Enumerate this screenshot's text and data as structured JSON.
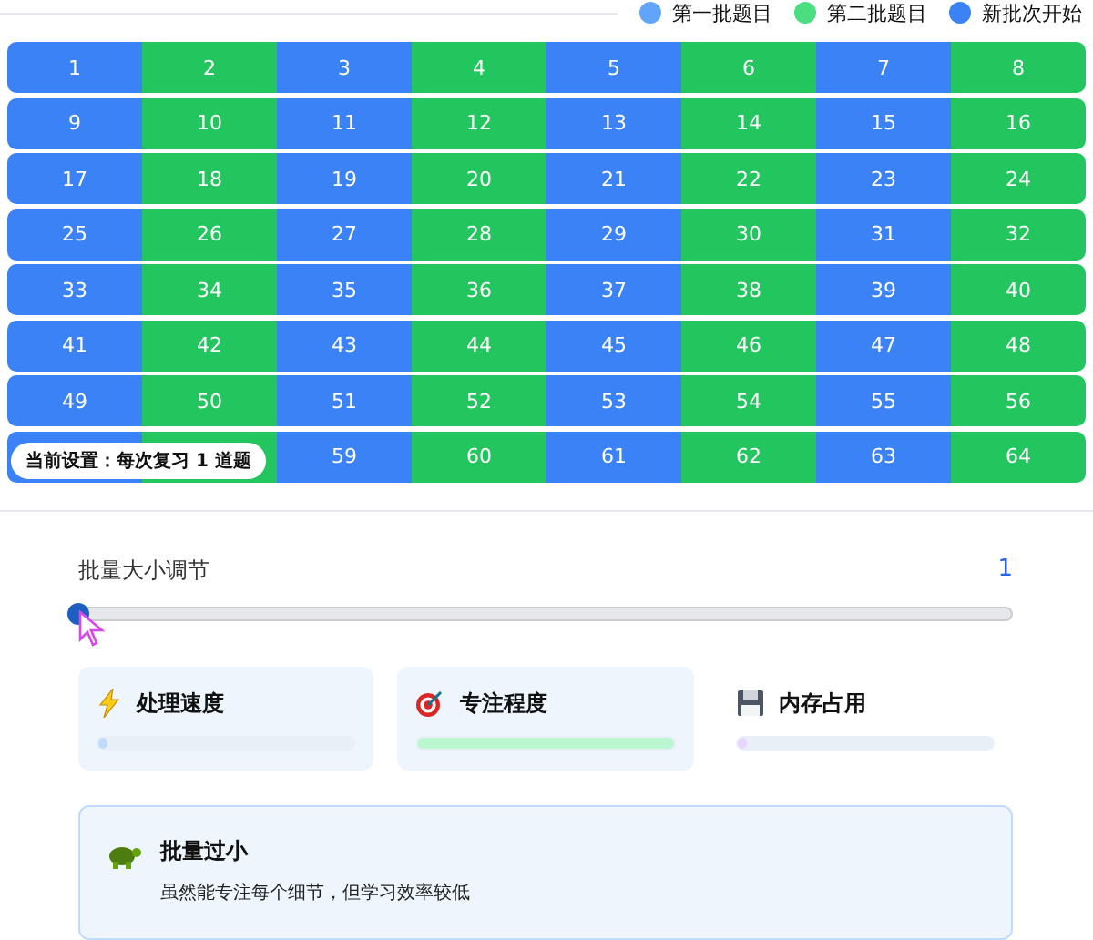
{
  "legend": [
    {
      "label": "第一批题目",
      "color": "#60a5fa"
    },
    {
      "label": "第二批题目",
      "color": "#4ade80"
    },
    {
      "label": "新批次开始",
      "color": "#3b82f6"
    }
  ],
  "grid": {
    "cells": [
      {
        "label": "1",
        "color": "#3b82f6"
      },
      {
        "label": "2",
        "color": "#22c55e"
      },
      {
        "label": "3",
        "color": "#3b82f6"
      },
      {
        "label": "4",
        "color": "#22c55e"
      },
      {
        "label": "5",
        "color": "#3b82f6"
      },
      {
        "label": "6",
        "color": "#22c55e"
      },
      {
        "label": "7",
        "color": "#3b82f6"
      },
      {
        "label": "8",
        "color": "#22c55e"
      },
      {
        "label": "9",
        "color": "#3b82f6"
      },
      {
        "label": "10",
        "color": "#22c55e"
      },
      {
        "label": "11",
        "color": "#3b82f6"
      },
      {
        "label": "12",
        "color": "#22c55e"
      },
      {
        "label": "13",
        "color": "#3b82f6"
      },
      {
        "label": "14",
        "color": "#22c55e"
      },
      {
        "label": "15",
        "color": "#3b82f6"
      },
      {
        "label": "16",
        "color": "#22c55e"
      },
      {
        "label": "17",
        "color": "#3b82f6"
      },
      {
        "label": "18",
        "color": "#22c55e"
      },
      {
        "label": "19",
        "color": "#3b82f6"
      },
      {
        "label": "20",
        "color": "#22c55e"
      },
      {
        "label": "21",
        "color": "#3b82f6"
      },
      {
        "label": "22",
        "color": "#22c55e"
      },
      {
        "label": "23",
        "color": "#3b82f6"
      },
      {
        "label": "24",
        "color": "#22c55e"
      },
      {
        "label": "25",
        "color": "#3b82f6"
      },
      {
        "label": "26",
        "color": "#22c55e"
      },
      {
        "label": "27",
        "color": "#3b82f6"
      },
      {
        "label": "28",
        "color": "#22c55e"
      },
      {
        "label": "29",
        "color": "#3b82f6"
      },
      {
        "label": "30",
        "color": "#22c55e"
      },
      {
        "label": "31",
        "color": "#3b82f6"
      },
      {
        "label": "32",
        "color": "#22c55e"
      },
      {
        "label": "33",
        "color": "#3b82f6"
      },
      {
        "label": "34",
        "color": "#22c55e"
      },
      {
        "label": "35",
        "color": "#3b82f6"
      },
      {
        "label": "36",
        "color": "#22c55e"
      },
      {
        "label": "37",
        "color": "#3b82f6"
      },
      {
        "label": "38",
        "color": "#22c55e"
      },
      {
        "label": "39",
        "color": "#3b82f6"
      },
      {
        "label": "40",
        "color": "#22c55e"
      },
      {
        "label": "41",
        "color": "#3b82f6"
      },
      {
        "label": "42",
        "color": "#22c55e"
      },
      {
        "label": "43",
        "color": "#3b82f6"
      },
      {
        "label": "44",
        "color": "#22c55e"
      },
      {
        "label": "45",
        "color": "#3b82f6"
      },
      {
        "label": "46",
        "color": "#22c55e"
      },
      {
        "label": "47",
        "color": "#3b82f6"
      },
      {
        "label": "48",
        "color": "#22c55e"
      },
      {
        "label": "49",
        "color": "#3b82f6"
      },
      {
        "label": "50",
        "color": "#22c55e"
      },
      {
        "label": "51",
        "color": "#3b82f6"
      },
      {
        "label": "52",
        "color": "#22c55e"
      },
      {
        "label": "53",
        "color": "#3b82f6"
      },
      {
        "label": "54",
        "color": "#22c55e"
      },
      {
        "label": "55",
        "color": "#3b82f6"
      },
      {
        "label": "56",
        "color": "#22c55e"
      },
      {
        "color": "#3b82f6"
      },
      {
        "color": "#22c55e"
      },
      {
        "label": "59",
        "color": "#3b82f6"
      },
      {
        "label": "60",
        "color": "#22c55e"
      },
      {
        "label": "61",
        "color": "#3b82f6"
      },
      {
        "label": "62",
        "color": "#22c55e"
      },
      {
        "label": "63",
        "color": "#3b82f6"
      },
      {
        "label": "64",
        "color": "#22c55e"
      }
    ],
    "badge": "当前设置：每次复习 1 道题"
  },
  "slider": {
    "label": "批量大小调节",
    "reading": "1",
    "level": 0
  },
  "metrics": [
    {
      "kind": "speed",
      "title": "处理速度",
      "level": 0.03,
      "color": "#bfdbfe",
      "highlighted": true
    },
    {
      "kind": "focus",
      "title": "专注程度",
      "level": 1,
      "color": "#bbf7d0",
      "highlighted": true
    },
    {
      "kind": "memory",
      "title": "内存占用",
      "level": 0.03,
      "color": "#e9d5ff",
      "highlighted": false
    }
  ],
  "notice": {
    "title": "批量过小",
    "text": "虽然能专注每个细节，但学习效率较低"
  }
}
